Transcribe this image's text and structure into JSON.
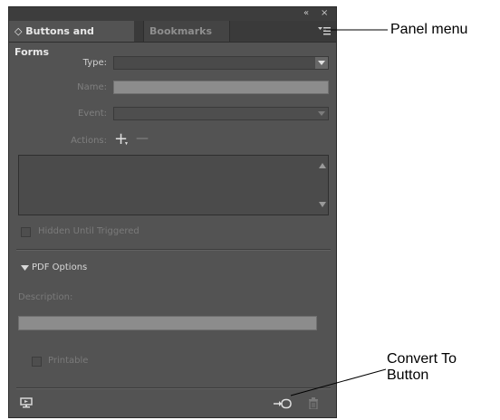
{
  "window": {
    "collapse_glyph": "«",
    "close_glyph": "×"
  },
  "tabs": [
    {
      "label": "◇ Buttons and Forms",
      "active": true
    },
    {
      "label": "Bookmarks",
      "active": false
    }
  ],
  "form": {
    "type_label": "Type:",
    "name_label": "Name:",
    "event_label": "Event:",
    "actions_label": "Actions:",
    "add_glyph": "+",
    "remove_glyph": "—"
  },
  "hidden_until_triggered": "Hidden Until Triggered",
  "pdf_options": {
    "toggle_label": "PDF Options",
    "description_label": "Description:",
    "printable_label": "Printable"
  },
  "callouts": {
    "panel_menu": "Panel menu",
    "convert_line1": "Convert To",
    "convert_line2": "Button"
  },
  "colors": {
    "panel_bg": "#535353",
    "tab_strip": "#3a3a3a",
    "text_active": "#e8e8e8",
    "text_dim": "#8a8a8a"
  },
  "icons": [
    "collapse-icon",
    "close-icon",
    "panel-menu-icon",
    "add-action-icon",
    "remove-action-icon",
    "disclosure-triangle-icon",
    "preview-icon",
    "convert-to-button-icon",
    "trash-icon"
  ]
}
